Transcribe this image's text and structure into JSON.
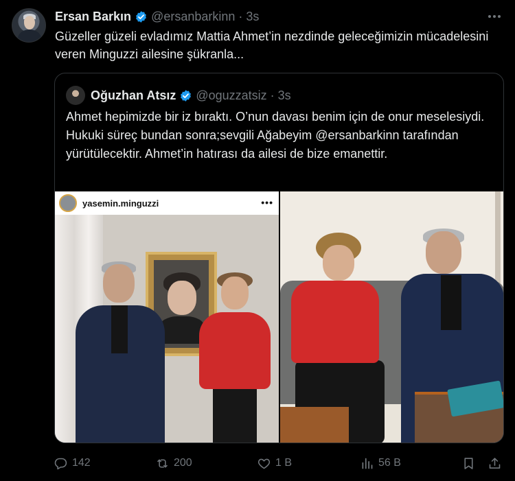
{
  "tweet": {
    "author_name": "Ersan Barkın",
    "author_handle": "@ersanbarkinn",
    "separator": "·",
    "time": "3s",
    "text": "Güzeller güzeli evladımız Mattia Ahmet’in nezdinde geleceğimizin mücadelesini veren Minguzzi ailesine şükranla..."
  },
  "quote": {
    "author_name": "Oğuzhan Atsız",
    "author_handle": "@oguzzatsiz",
    "separator": "·",
    "time": "3s",
    "text": "Ahmet hepimizde bir iz bıraktı. O’nun davası benim için de onur meselesiydi. Hukuki süreç bundan sonra;sevgili Ağabeyim @ersanbarkinn tarafından yürütülecektir. Ahmet’in hatırası da ailesi de bize emanettir.",
    "media_left_username": "yasemin.minguzzi",
    "media_left_more": "•••"
  },
  "actions": {
    "replies": "142",
    "reposts": "200",
    "likes": "1 B",
    "views": "56 B"
  },
  "colors": {
    "verified": "#1d9bf0",
    "muted": "#71767b",
    "text": "#e7e9ea",
    "border": "#2f3336"
  },
  "icons": [
    "verified-badge-icon",
    "more-icon",
    "reply-icon",
    "repost-icon",
    "like-icon",
    "views-icon",
    "bookmark-icon",
    "share-icon"
  ]
}
